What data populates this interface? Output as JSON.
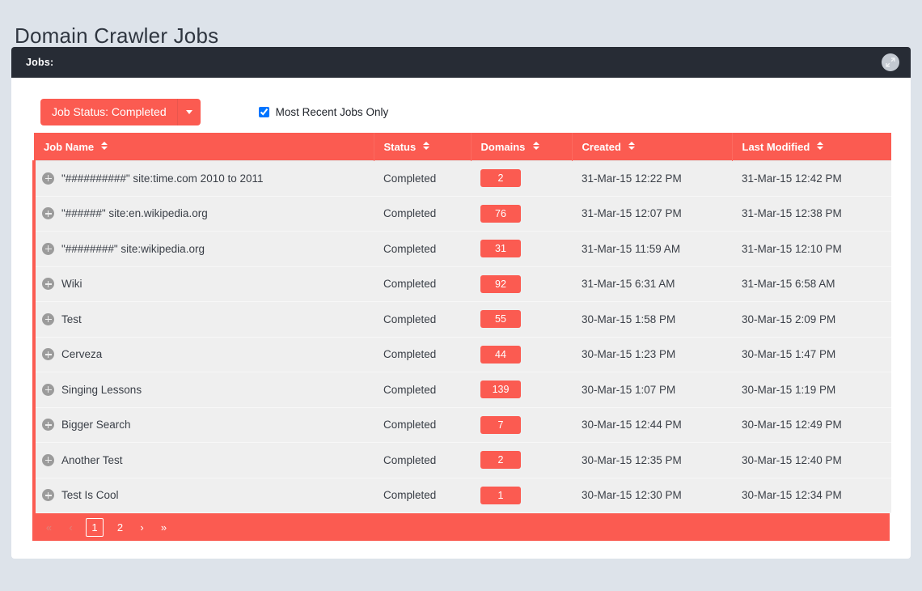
{
  "page": {
    "title": "Domain Crawler Jobs"
  },
  "panel": {
    "title": "Jobs:",
    "expand_icon": "resize-expand-icon"
  },
  "toolbar": {
    "status_filter_label": "Job Status: Completed",
    "caret_icon": "chevron-down-icon",
    "checkbox_label": "Most Recent Jobs Only",
    "checkbox_checked": true
  },
  "table": {
    "columns": [
      {
        "label": "Job Name",
        "sort_icon": "sort-arrows-icon"
      },
      {
        "label": "Status",
        "sort_icon": "sort-arrows-icon"
      },
      {
        "label": "Domains",
        "sort_icon": "sort-arrows-icon"
      },
      {
        "label": "Created",
        "sort_icon": "sort-arrows-icon"
      },
      {
        "label": "Last Modified",
        "sort_icon": "sort-arrows-icon"
      }
    ],
    "rows": [
      {
        "name": "\"##########\" site:time.com 2010 to 2011",
        "status": "Completed",
        "domains": "2",
        "created": "31-Mar-15 12:22 PM",
        "modified": "31-Mar-15 12:42 PM"
      },
      {
        "name": "\"######\" site:en.wikipedia.org",
        "status": "Completed",
        "domains": "76",
        "created": "31-Mar-15 12:07 PM",
        "modified": "31-Mar-15 12:38 PM"
      },
      {
        "name": "\"########\" site:wikipedia.org",
        "status": "Completed",
        "domains": "31",
        "created": "31-Mar-15 11:59 AM",
        "modified": "31-Mar-15 12:10 PM"
      },
      {
        "name": "Wiki",
        "status": "Completed",
        "domains": "92",
        "created": "31-Mar-15 6:31 AM",
        "modified": "31-Mar-15 6:58 AM"
      },
      {
        "name": "Test",
        "status": "Completed",
        "domains": "55",
        "created": "30-Mar-15 1:58 PM",
        "modified": "30-Mar-15 2:09 PM"
      },
      {
        "name": "Cerveza",
        "status": "Completed",
        "domains": "44",
        "created": "30-Mar-15 1:23 PM",
        "modified": "30-Mar-15 1:47 PM"
      },
      {
        "name": "Singing Lessons",
        "status": "Completed",
        "domains": "139",
        "created": "30-Mar-15 1:07 PM",
        "modified": "30-Mar-15 1:19 PM"
      },
      {
        "name": "Bigger Search",
        "status": "Completed",
        "domains": "7",
        "created": "30-Mar-15 12:44 PM",
        "modified": "30-Mar-15 12:49 PM"
      },
      {
        "name": "Another Test",
        "status": "Completed",
        "domains": "2",
        "created": "30-Mar-15 12:35 PM",
        "modified": "30-Mar-15 12:40 PM"
      },
      {
        "name": "Test Is Cool",
        "status": "Completed",
        "domains": "1",
        "created": "30-Mar-15 12:30 PM",
        "modified": "30-Mar-15 12:34 PM"
      }
    ]
  },
  "pagination": {
    "first": "«",
    "prev": "‹",
    "pages": [
      "1",
      "2"
    ],
    "current_page": "1",
    "next": "›",
    "last": "»"
  },
  "colors": {
    "accent": "#fb5b51",
    "panel_header": "#272c35",
    "page_background": "#dde3ea",
    "row_background": "#efefef"
  }
}
